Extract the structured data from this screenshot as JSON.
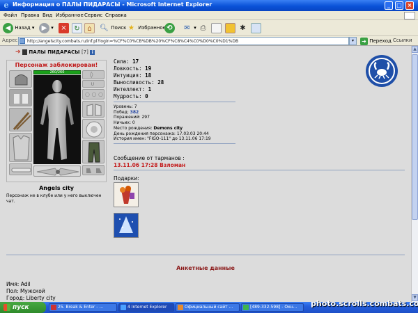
{
  "window": {
    "title": "Информация о ПАЛЫ ПИДАРАСЫ - Microsoft Internet Explorer",
    "icon": "ie-logo-icon"
  },
  "menu": [
    "Файл",
    "Правка",
    "Вид",
    "Избранное",
    "Сервис",
    "Справка"
  ],
  "toolbar": {
    "back_label": "Назад",
    "search_label": "Поиск",
    "favorites_label": "Избранное"
  },
  "address": {
    "label": "Адрес:",
    "url": "http://angelscity.combats.ru/inf.pl?login=%CF%C0%CB%DB%20%CF%C8%C4%C0%D0%C0%D1%DB",
    "go_label": "Переход",
    "links_label": "Ссылки"
  },
  "character": {
    "name": "ПАЛЫ ПИДАРАСЫ",
    "level": "[7]",
    "info_badge": "i",
    "status": "Персонаж заблокирован!",
    "hp": "260/260",
    "hp_fraction": 1.0,
    "city": "Angels city",
    "notice": "Персонаж не в клубе или у него выключен чат."
  },
  "stats": [
    {
      "label": "Сила:",
      "value": "17"
    },
    {
      "label": "Ловкость:",
      "value": "19"
    },
    {
      "label": "Интуиция:",
      "value": "18"
    },
    {
      "label": "Выносливость:",
      "value": "28"
    },
    {
      "label": "Интеллект:",
      "value": "1"
    },
    {
      "label": "Мудрость:",
      "value": "0"
    }
  ],
  "info": {
    "level": {
      "label": "Уровень:",
      "value": "7"
    },
    "wins": {
      "label": "Побед:",
      "value": "382"
    },
    "losses": {
      "label": "Поражений:",
      "value": "297"
    },
    "draws": {
      "label": "Ничьих:",
      "value": "0"
    },
    "birthplace": {
      "label": "Место рождения:",
      "value": "Demons city"
    },
    "birthday": {
      "label": "День рождения персонажа:",
      "value": "17.03.03 20:44"
    },
    "name_history": {
      "label": "История имен:",
      "value": "\"FIGO-111\" до 13.11.06 17:19"
    }
  },
  "message": {
    "title": "Сообщение от тарманов :",
    "text": "13.11.06 17:28 Взломан"
  },
  "gifts": {
    "title": "Подарки:",
    "items": [
      "gift-flowers-icon",
      "gift-winter-tree-icon"
    ]
  },
  "clan_emblem": "crab-emblem-icon",
  "profile": {
    "title": "Анкетные данные",
    "name": {
      "label": "Имя:",
      "value": "Adil"
    },
    "gender": {
      "label": "Пол:",
      "value": "Мужской"
    },
    "city": {
      "label": "Город:",
      "value": "Liberty city"
    }
  },
  "taskbar": {
    "start_label": "пуск",
    "tasks": [
      "25. Break & Enter - ...",
      "4 Internet Explorer",
      "Официальный сайт ...",
      "[489-332-598] - Окн..."
    ]
  },
  "watermark": "photo.scrolls.combats.com",
  "colors": {
    "titlebar": "#0a52d8",
    "blocked_text": "#c01818",
    "message_text": "#c41e1e",
    "profile_title": "#8b1a1a",
    "hp_bar": "#19a019",
    "link_blue": "#1c3fa0",
    "emblem": "#1f4fa8"
  }
}
